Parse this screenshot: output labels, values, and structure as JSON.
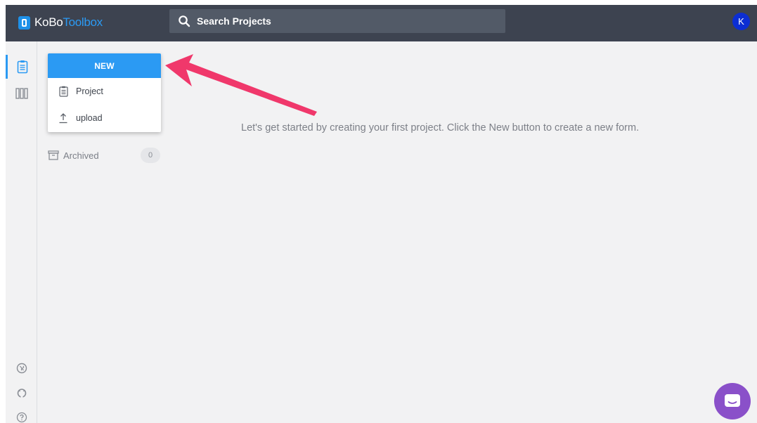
{
  "brand": {
    "name_part1": "KoBo",
    "name_part2": "Toolbox",
    "accent_color": "#2b9af3"
  },
  "search": {
    "placeholder": "Search Projects"
  },
  "user": {
    "initial": "K",
    "avatar_color": "#0c2ed3"
  },
  "rail": {
    "items": [
      {
        "icon": "clipboard-icon",
        "active": true
      },
      {
        "icon": "library-icon",
        "active": false
      }
    ],
    "bottom_items": [
      {
        "icon": "support-icon"
      },
      {
        "icon": "github-icon"
      },
      {
        "icon": "help-icon"
      }
    ]
  },
  "sidebar": {
    "archived_label": "Archived",
    "archived_count": "0"
  },
  "new_menu": {
    "button_label": "NEW",
    "items": [
      {
        "label": "Project",
        "icon": "clipboard-icon"
      },
      {
        "label": "upload",
        "icon": "upload-icon"
      }
    ]
  },
  "main": {
    "empty_message": "Let's get started by creating your first project. Click the New button to create a new form."
  },
  "annotation": {
    "arrow_color": "#f0386b"
  },
  "chat": {
    "icon": "chat-icon",
    "color": "#8a50c9"
  }
}
